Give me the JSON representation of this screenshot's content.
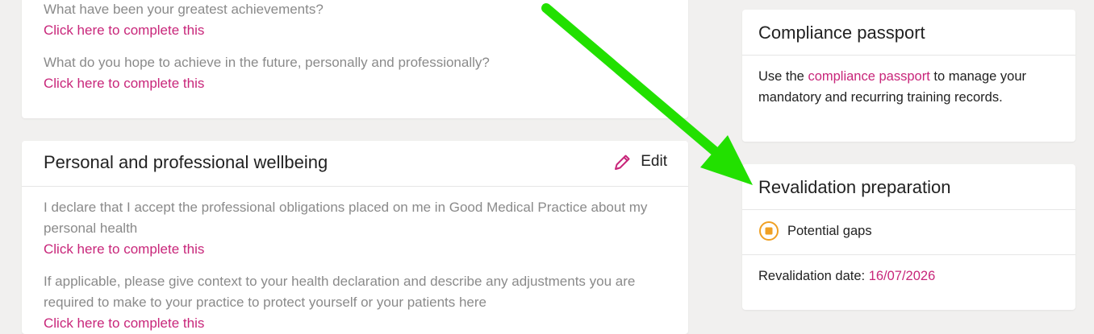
{
  "goals_card": {
    "q1": "What have been your greatest achievements?",
    "q1_link": "Click here to complete this",
    "q2": "What do you hope to achieve in the future, personally and professionally?",
    "q2_link": "Click here to complete this"
  },
  "wellbeing_card": {
    "title": "Personal and professional wellbeing",
    "edit_label": "Edit",
    "edit_icon": "pencil-icon",
    "q1": "I declare that I accept the professional obligations placed on me in Good Medical Practice about my personal health",
    "q1_link": "Click here to complete this",
    "q2": "If applicable, please give context to your health declaration and describe any adjustments you are required to make to your practice to protect yourself or your patients here",
    "q2_link": "Click here to complete this"
  },
  "compliance_card": {
    "title": "Compliance passport",
    "text_before": "Use the ",
    "link": "compliance passport",
    "text_after": " to manage your mandatory and recurring training records."
  },
  "revalidation_card": {
    "title": "Revalidation preparation",
    "status_label": "Potential gaps",
    "status_icon": "warning-status-icon",
    "date_label": "Revalidation date: ",
    "date_value": "16/07/2026"
  },
  "colors": {
    "accent": "#c8267a",
    "status_orange": "#f0a023",
    "annotation_arrow": "#22e000"
  }
}
